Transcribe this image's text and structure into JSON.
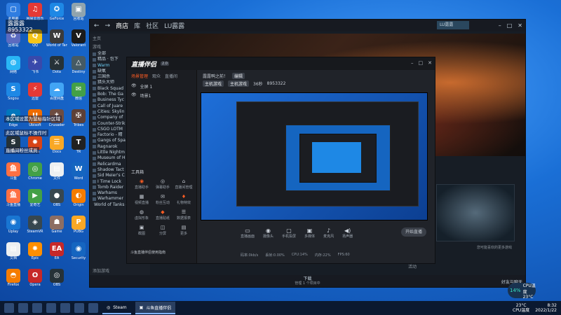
{
  "overlay": {
    "streamer_name": "露露露",
    "streamer_id": "8953322",
    "notes": [
      "本区域设置为鼠标指针区域",
      "此区域鼠标不操作时",
      "直播间粉丝成员"
    ]
  },
  "desktop": {
    "icons": [
      {
        "label": "此电脑",
        "color": "#2f7de1",
        "glyph": "▢"
      },
      {
        "label": "网易云音乐",
        "color": "#e53935",
        "glyph": "♫"
      },
      {
        "label": "GeForce",
        "color": "#1e88e5",
        "glyph": "✪"
      },
      {
        "label": "回收站",
        "color": "#90a4ae",
        "glyph": "▣"
      },
      {
        "label": "回收站",
        "color": "#5c6bc0",
        "glyph": "♻"
      },
      {
        "label": "QQ",
        "color": "#f5c518",
        "glyph": "Q"
      },
      {
        "label": "World of Tanks",
        "color": "#3b3b3b",
        "glyph": "W"
      },
      {
        "label": "Valorant",
        "color": "#1b1b1b",
        "glyph": "V"
      },
      {
        "label": "网络",
        "color": "#29b6f6",
        "glyph": "◍"
      },
      {
        "label": "飞书",
        "color": "#3949ab",
        "glyph": "✈"
      },
      {
        "label": "Dota",
        "color": "#263238",
        "glyph": "⚔"
      },
      {
        "label": "Destiny",
        "color": "#455a64",
        "glyph": "△"
      },
      {
        "label": "Sogou",
        "color": "#1e88e5",
        "glyph": "S"
      },
      {
        "label": "迅雷",
        "color": "#e53935",
        "glyph": "⚡"
      },
      {
        "label": "百度网盘",
        "color": "#42a5f5",
        "glyph": "☁"
      },
      {
        "label": "微信",
        "color": "#43a047",
        "glyph": "✉"
      },
      {
        "label": "Edge",
        "color": "#0277bd",
        "glyph": "e"
      },
      {
        "label": "Ubisoft",
        "color": "#ef6c00",
        "glyph": "U"
      },
      {
        "label": "Crusader",
        "color": "#6d4c41",
        "glyph": "✝"
      },
      {
        "label": "Tribes",
        "color": "#5d4037",
        "glyph": "✠"
      },
      {
        "label": "Steam",
        "color": "#263238",
        "glyph": "S"
      },
      {
        "label": "Arma",
        "color": "#d84315",
        "glyph": "✹"
      },
      {
        "label": "Docs",
        "color": "#f9a825",
        "glyph": "☰"
      },
      {
        "label": "TR",
        "color": "#212121",
        "glyph": "T"
      },
      {
        "label": "斗鱼",
        "color": "#ff7043",
        "glyph": "鱼"
      },
      {
        "label": "Chrome",
        "color": "#43a047",
        "glyph": "◎"
      },
      {
        "label": "文件",
        "color": "#eceff1",
        "glyph": "▤"
      },
      {
        "label": "Word",
        "color": "#1565c0",
        "glyph": "W"
      },
      {
        "label": "斗鱼直播",
        "color": "#ff7043",
        "glyph": "鱼"
      },
      {
        "label": "爱奇艺",
        "color": "#43a047",
        "glyph": "▶"
      },
      {
        "label": "OBS",
        "color": "#37474f",
        "glyph": "●"
      },
      {
        "label": "Origin",
        "color": "#f57c00",
        "glyph": "◐"
      },
      {
        "label": "Uplay",
        "color": "#1976d2",
        "glyph": "◉"
      },
      {
        "label": "SteamVR",
        "color": "#37474f",
        "glyph": "◈"
      },
      {
        "label": "Game",
        "color": "#8d6e63",
        "glyph": "☗"
      },
      {
        "label": "PUBG",
        "color": "#f9a825",
        "glyph": "P"
      },
      {
        "label": "文档",
        "color": "#eceff1",
        "glyph": "▤"
      },
      {
        "label": "Epic",
        "color": "#ff8f00",
        "glyph": "✸"
      },
      {
        "label": "EA",
        "color": "#c62828",
        "glyph": "EA"
      },
      {
        "label": "Security",
        "color": "#1565c0",
        "glyph": "◉"
      },
      {
        "label": "Firefox",
        "color": "#f57c00",
        "glyph": "◓"
      },
      {
        "label": "Opera",
        "color": "#c62828",
        "glyph": "O"
      },
      {
        "label": "OBS",
        "color": "#263238",
        "glyph": "◎"
      }
    ]
  },
  "steam": {
    "back": "←",
    "forward": "→",
    "menu": [
      "商店",
      "库",
      "社区",
      "LU露露"
    ],
    "user_tag": "LU露露",
    "winbtns": [
      "–",
      "□",
      "✕"
    ],
    "home": "主页",
    "section": "游戏",
    "games": [
      "全部",
      "精品 · 包下",
      "Warm",
      "缺氧",
      "三国杀",
      "猎头大师",
      "Black Squad",
      "Bob: The Ga",
      "Business Tyc",
      "Call of Juare",
      "Cities: Skylin",
      "Company of",
      "Counter-Strik",
      "CSGO LOTM",
      "Factorio - 精",
      "Gangs of Spa",
      "Ragnarok",
      "Little Nightm",
      "Museum of H",
      "Relicardma",
      "Shadow Tact",
      "Sid Meier's C",
      "I Time Lock",
      "Tomb Raider",
      "Warhams",
      "Warhammer",
      "World of Tanks - 包下更新队列中"
    ],
    "add_game": "添加游戏",
    "thumb_label": "您可能喜欢的更多游戏",
    "activity": "活动",
    "download": "下载",
    "download_sub": "管理 1 个项目中",
    "friends": "好友与聊天"
  },
  "doyu": {
    "logo": "直播伴侣",
    "badge": "2.0",
    "winbtns": [
      "–",
      "□",
      "✕"
    ],
    "scene_tabs": [
      "场景管理",
      "观众",
      "直播间"
    ],
    "scenes": [
      {
        "vis": "👁",
        "name": "全屏 1"
      },
      {
        "vis": "👁",
        "name": "场景1"
      }
    ],
    "room_title": "露露鸭之前！",
    "room_edit": "编辑",
    "room_tags": [
      "主机游戏",
      "主机游戏"
    ],
    "room_count": "36秒",
    "room_id": "8953322",
    "toolbox": "工具箱",
    "tools": [
      {
        "icon": "◉",
        "label": "直播助手",
        "orange": true
      },
      {
        "icon": "◎",
        "label": "弹幕助手",
        "orange": false
      },
      {
        "icon": "⌂",
        "label": "直播间管理",
        "orange": false
      },
      {
        "icon": "▦",
        "label": "视频直播",
        "orange": false
      },
      {
        "icon": "✉",
        "label": "粉丝互动",
        "orange": false
      },
      {
        "icon": "♦",
        "label": "礼物特效",
        "orange": true
      },
      {
        "icon": "◍",
        "label": "虚拟形象",
        "orange": false
      },
      {
        "icon": "◆",
        "label": "直播贴纸",
        "orange": true
      },
      {
        "icon": "☰",
        "label": "数据报表",
        "orange": false
      },
      {
        "icon": "▣",
        "label": "截图",
        "orange": false
      },
      {
        "icon": "◫",
        "label": "分屏",
        "orange": false
      },
      {
        "icon": "▤",
        "label": "更多",
        "orange": false
      }
    ],
    "sel_hint": "斗鱼直播伴侣使用指南",
    "controls": [
      {
        "icon": "▭",
        "label": "直播画面"
      },
      {
        "icon": "◉",
        "label": "摄像头"
      },
      {
        "icon": "▢",
        "label": "手机投屏"
      },
      {
        "icon": "▣",
        "label": "多媒体"
      },
      {
        "icon": "♪",
        "label": "麦克风"
      },
      {
        "icon": "◀)",
        "label": "扬声器"
      }
    ],
    "start": "开始直播",
    "stats": [
      "码率:0kb/s",
      "丢帧:0.00%",
      "CPU:14%",
      "内存:22%",
      "FPS:60"
    ]
  },
  "taskbar": {
    "apps": [
      {
        "label": "Steam",
        "active": false
      },
      {
        "label": "斗鱼直播伴侣",
        "active": true
      }
    ],
    "temp": "23°C",
    "temp_sub": "CPU温度",
    "time": "8:32",
    "date": "2022/1/22",
    "cpu_pct": "14%",
    "cpu_label": "CPU温度 23°C"
  }
}
